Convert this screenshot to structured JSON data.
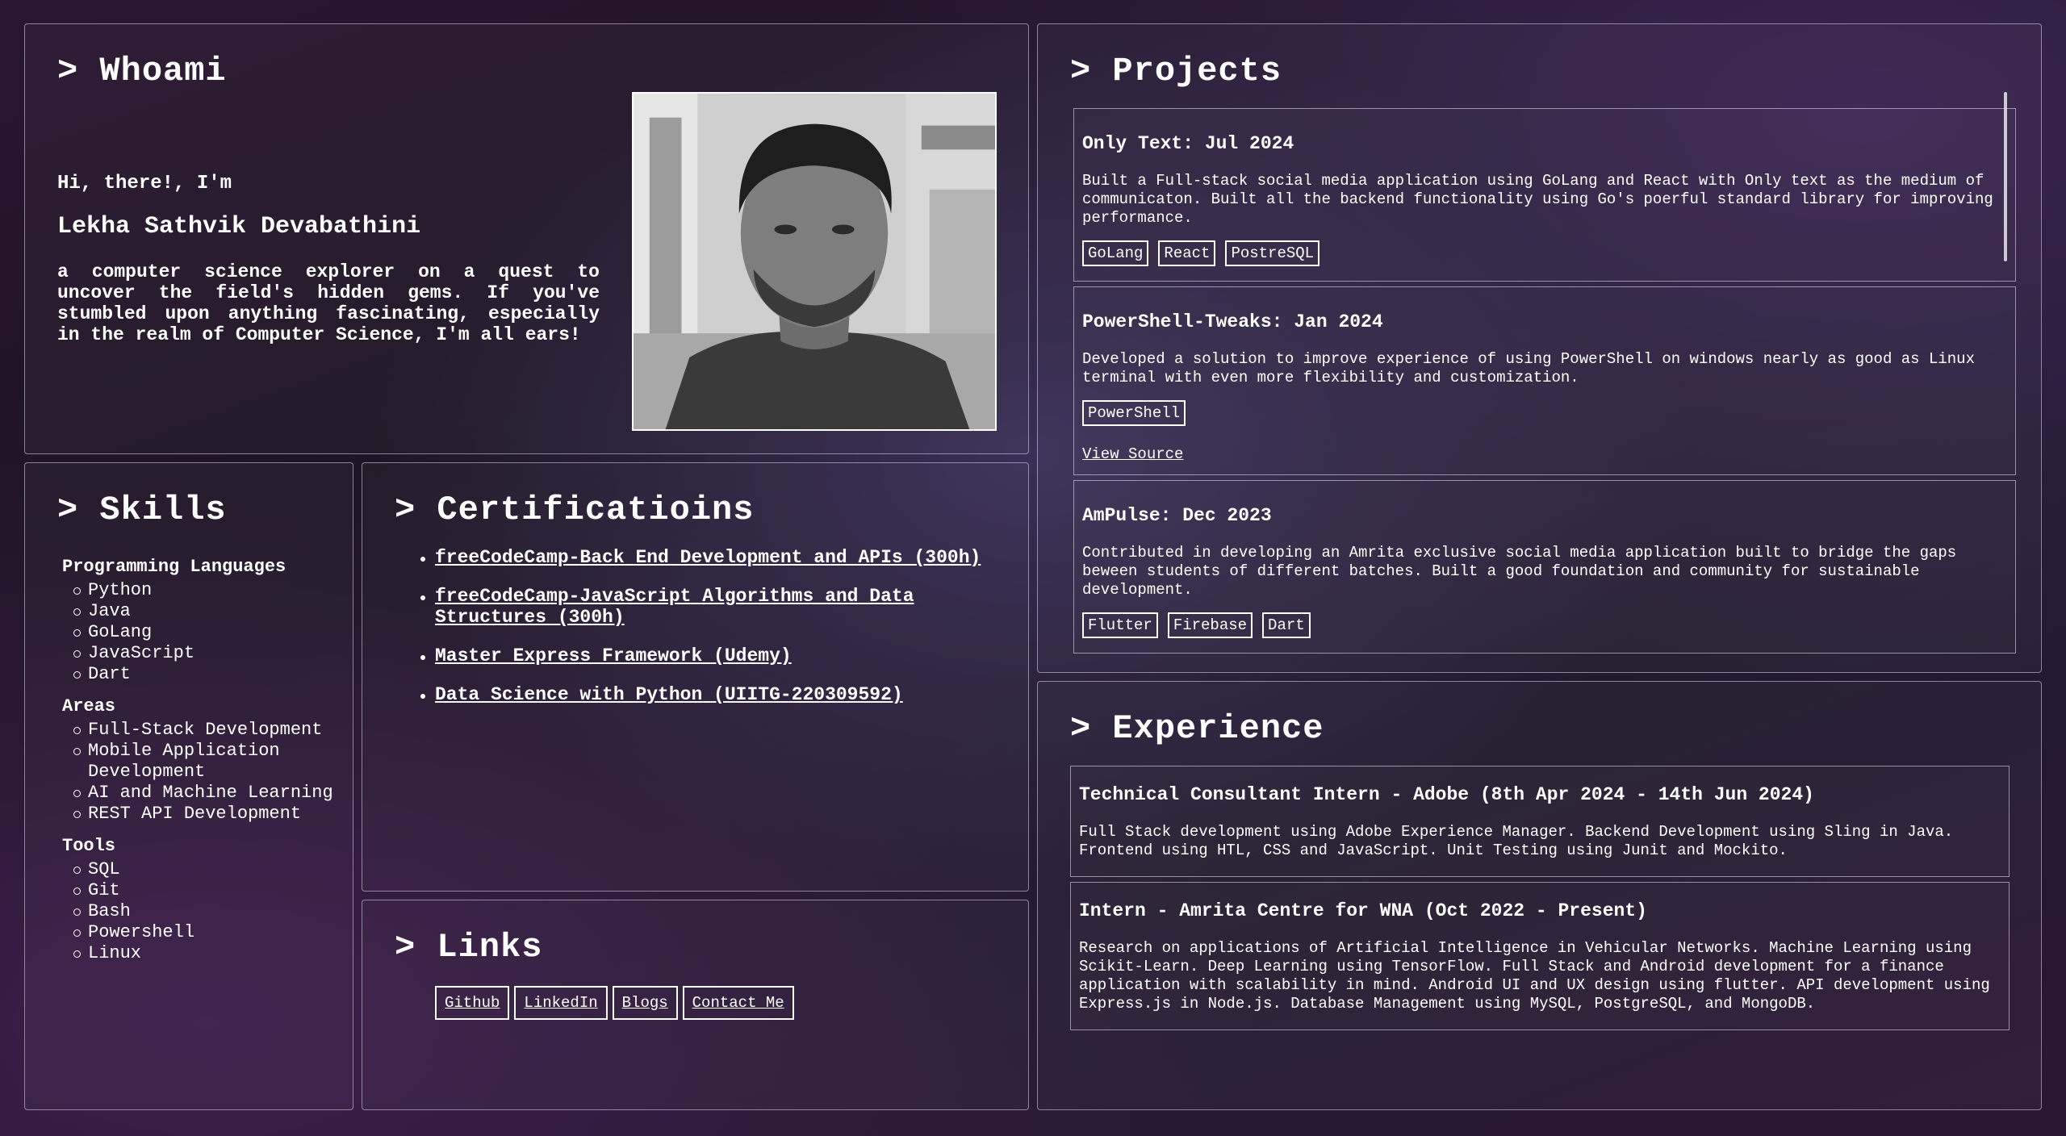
{
  "whoami": {
    "title": "> Whoami",
    "greeting": "Hi, there!, I'm",
    "name": "Lekha Sathvik Devabathini",
    "bio": "a computer science explorer on a quest to uncover the field's hidden gems. If you've stumbled upon anything fascinating, especially in the realm of Computer Science, I'm all ears!"
  },
  "skills": {
    "title": "> Skills",
    "groups": [
      {
        "name": "Programming Languages",
        "items": [
          "Python",
          "Java",
          "GoLang",
          "JavaScript",
          "Dart"
        ]
      },
      {
        "name": "Areas",
        "items": [
          "Full-Stack Development",
          "Mobile Application Development",
          "AI and Machine Learning",
          "REST API Development"
        ]
      },
      {
        "name": "Tools",
        "items": [
          "SQL",
          "Git",
          "Bash",
          "Powershell",
          "Linux"
        ]
      }
    ]
  },
  "certifications": {
    "title": "> Certificatioins",
    "items": [
      "freeCodeCamp-Back End Development and APIs (300h)",
      "freeCodeCamp-JavaScript Algorithms and Data Structures (300h)",
      "Master Express Framework (Udemy)",
      "Data Science with Python (UIITG-220309592)"
    ]
  },
  "links": {
    "title": "> Links",
    "items": [
      "Github",
      "LinkedIn",
      "Blogs",
      "Contact Me"
    ]
  },
  "projects": {
    "title": "> Projects",
    "items": [
      {
        "title": "Only Text: Jul 2024",
        "desc": "Built a Full-stack social media application using GoLang and React with Only text as the medium of communicaton. Built all the backend functionality using Go's poerful standard library for improving performance.",
        "tags": [
          "GoLang",
          "React",
          "PostreSQL"
        ]
      },
      {
        "title": "PowerShell-Tweaks: Jan 2024",
        "desc": "Developed a solution to improve experience of using PowerShell on windows nearly as good as Linux terminal with even more flexibility and customization.",
        "tags": [
          "PowerShell"
        ],
        "link": "View Source"
      },
      {
        "title": "AmPulse: Dec 2023",
        "desc": "Contributed in developing an Amrita exclusive social media application built to bridge the gaps beween students of different batches. Built a good foundation and community for sustainable development.",
        "tags": [
          "Flutter",
          "Firebase",
          "Dart"
        ]
      }
    ]
  },
  "experience": {
    "title": "> Experience",
    "items": [
      {
        "title": "Technical Consultant Intern - Adobe (8th Apr 2024 - 14th Jun 2024)",
        "desc": "Full Stack development using Adobe Experience Manager. Backend Development using Sling in Java. Frontend using HTL, CSS and JavaScript. Unit Testing using Junit and Mockito."
      },
      {
        "title": "Intern - Amrita Centre for WNA (Oct 2022 - Present)",
        "desc": "Research on applications of Artificial Intelligence in Vehicular Networks. Machine Learning using Scikit-Learn. Deep Learning using TensorFlow. Full Stack and Android development for a finance application with scalability in mind. Android UI and UX design using flutter. API development using Express.js in Node.js. Database Management using MySQL, PostgreSQL, and MongoDB."
      }
    ]
  }
}
